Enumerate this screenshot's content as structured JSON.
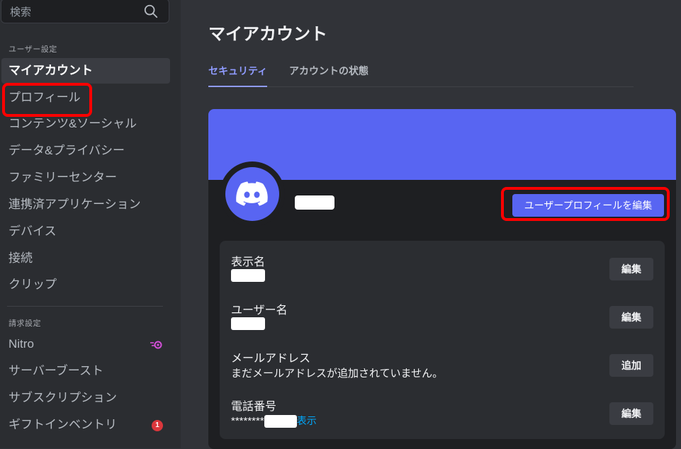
{
  "sidebar": {
    "search_placeholder": "検索",
    "user_settings_header": "ユーザー設定",
    "user_items": [
      {
        "label": "マイアカウント"
      },
      {
        "label": "プロフィール"
      },
      {
        "label": "コンテンツ&ソーシャル"
      },
      {
        "label": "データ&プライバシー"
      },
      {
        "label": "ファミリーセンター"
      },
      {
        "label": "連携済アプリケーション"
      },
      {
        "label": "デバイス"
      },
      {
        "label": "接続"
      },
      {
        "label": "クリップ"
      }
    ],
    "billing_header": "請求設定",
    "billing_items": [
      {
        "label": "Nitro"
      },
      {
        "label": "サーバーブースト"
      },
      {
        "label": "サブスクリプション"
      },
      {
        "label": "ギフトインベントリ",
        "badge": "1"
      }
    ]
  },
  "main": {
    "title": "マイアカウント",
    "tabs": [
      {
        "label": "セキュリティ",
        "active": true
      },
      {
        "label": "アカウントの状態",
        "active": false
      }
    ],
    "edit_profile_button": "ユーザープロフィールを編集",
    "fields": [
      {
        "label": "表示名",
        "button": "編集"
      },
      {
        "label": "ユーザー名",
        "button": "編集"
      },
      {
        "label": "メールアドレス",
        "value": "まだメールアドレスが追加されていません。",
        "button": "追加"
      },
      {
        "label": "電話番号",
        "value_prefix": "********",
        "reveal": "表示",
        "button": "編集"
      }
    ]
  },
  "colors": {
    "accent": "#5865f2",
    "highlight": "#ff0000",
    "badge": "#da373c"
  }
}
